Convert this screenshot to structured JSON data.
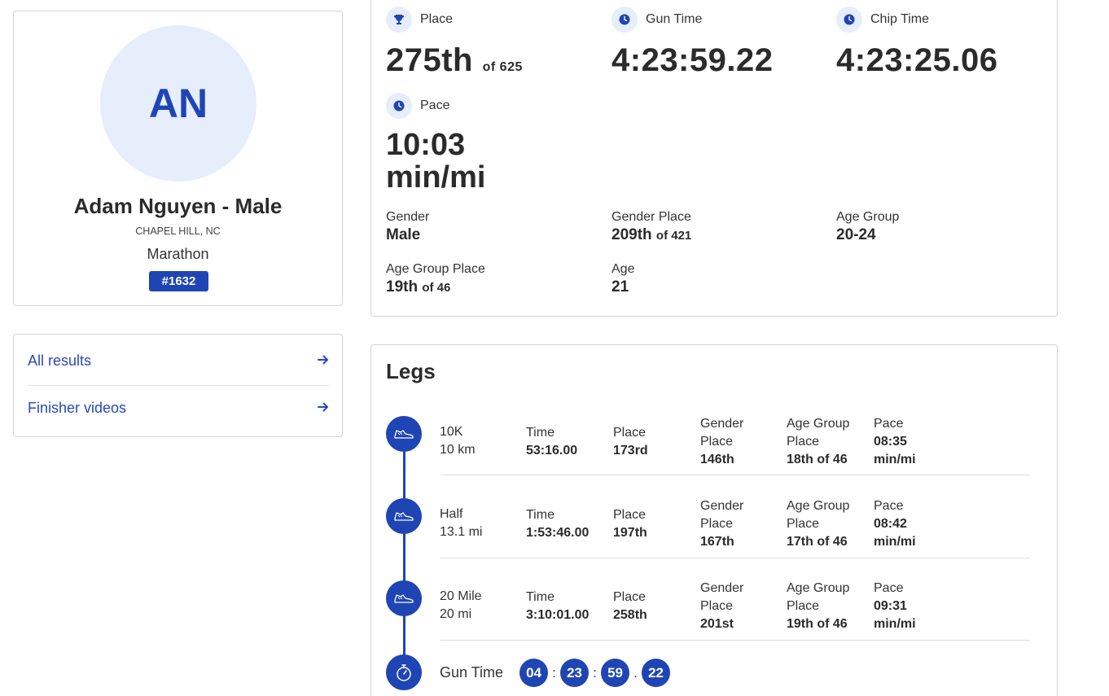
{
  "profile": {
    "initials": "AN",
    "name": "Adam Nguyen - Male",
    "location": "CHAPEL HILL, NC",
    "event": "Marathon",
    "bib": "#1632"
  },
  "links": [
    {
      "label": "All results",
      "icon": "arrow-right-icon"
    },
    {
      "label": "Finisher videos",
      "icon": "arrow-right-icon"
    }
  ],
  "summary": {
    "place": {
      "label": "Place",
      "value": "275th",
      "of": "of 625",
      "icon": "trophy-icon"
    },
    "gun_time": {
      "label": "Gun Time",
      "value": "4:23:59.22",
      "icon": "clock-icon"
    },
    "chip_time": {
      "label": "Chip Time",
      "value": "4:23:25.06",
      "icon": "clock-icon"
    },
    "pace": {
      "label": "Pace",
      "value_line1": "10:03",
      "value_line2": "min/mi",
      "icon": "clock-icon"
    },
    "gender": {
      "label": "Gender",
      "value": "Male"
    },
    "gender_place": {
      "label": "Gender Place",
      "value": "209th",
      "of": "of 421"
    },
    "age_group": {
      "label": "Age Group",
      "value": "20-24"
    },
    "age_group_place": {
      "label": "Age Group Place",
      "value": "19th",
      "of": "of 46"
    },
    "age": {
      "label": "Age",
      "value": "21"
    }
  },
  "legs": {
    "title": "Legs",
    "labels": {
      "time": "Time",
      "place": "Place",
      "gender_place_1": "Gender",
      "gender_place_2": "Place",
      "age_group_place_1": "Age Group",
      "age_group_place_2": "Place",
      "pace": "Pace",
      "pace_unit": "min/mi"
    },
    "rows": [
      {
        "name": "10K",
        "distance": "10 km",
        "time": "53:16.00",
        "place": "173rd",
        "gender_place": "146th",
        "age_group_place": "18th of 46",
        "pace": "08:35"
      },
      {
        "name": "Half",
        "distance": "13.1 mi",
        "time": "1:53:46.00",
        "place": "197th",
        "gender_place": "167th",
        "age_group_place": "17th of 46",
        "pace": "08:42"
      },
      {
        "name": "20 Mile",
        "distance": "20 mi",
        "time": "3:10:01.00",
        "place": "258th",
        "gender_place": "201st",
        "age_group_place": "19th of 46",
        "pace": "09:31"
      }
    ],
    "gun_time": {
      "label": "Gun Time",
      "hours": "04",
      "minutes": "23",
      "seconds": "59",
      "hundredths": "22",
      "sep1": ":",
      "sep2": ":",
      "sep3": "."
    }
  },
  "colors": {
    "accent": "#1f45b5",
    "accent_light": "#e6edfb",
    "link": "#2b48b8",
    "border": "#cfd3da"
  }
}
